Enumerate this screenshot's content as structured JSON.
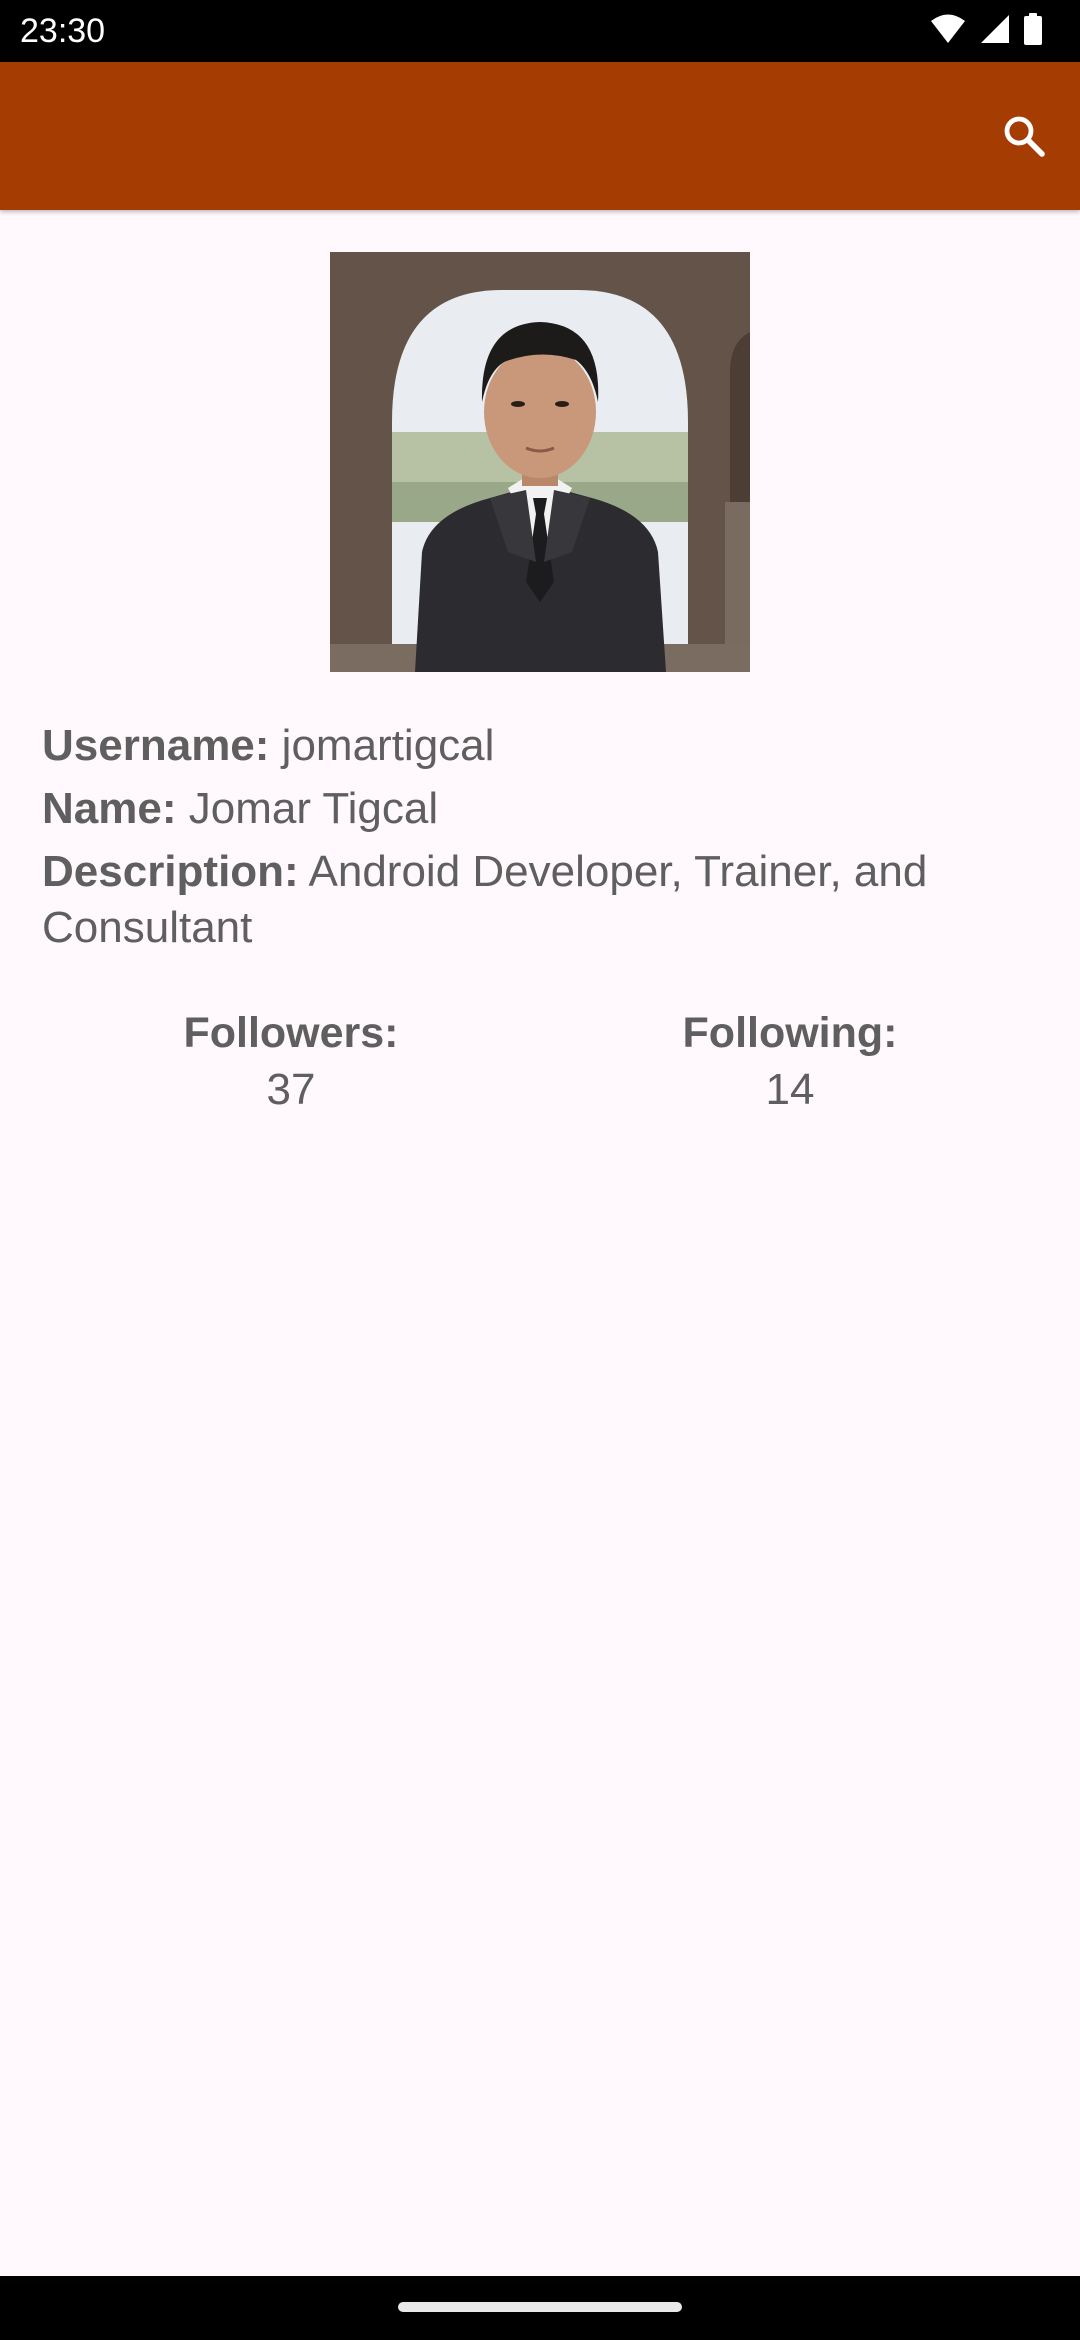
{
  "status_bar": {
    "time": "23:30",
    "icons": [
      "wifi-icon",
      "cellular-signal-icon",
      "battery-icon"
    ]
  },
  "app_bar": {
    "color": "#A53C02",
    "action_icon": "search-icon"
  },
  "profile": {
    "username_label": "Username:",
    "username": "jomartigcal",
    "name_label": "Name:",
    "name": "Jomar Tigcal",
    "description_label": "Description:",
    "description": "Android Developer, Trainer, and Consultant",
    "followers_label": "Followers:",
    "followers": "37",
    "following_label": "Following:",
    "following": "14"
  }
}
